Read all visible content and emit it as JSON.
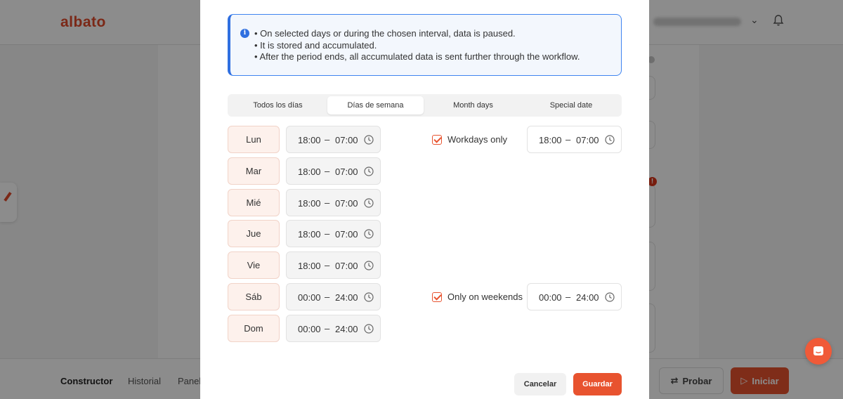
{
  "app": {
    "logo": "albato",
    "footer_tabs": [
      "Constructor",
      "Historial",
      "Panel"
    ],
    "probar_label": "Probar",
    "iniciar_label": "Iniciar"
  },
  "modal": {
    "info_lines": [
      "On selected days or during the chosen interval, data is paused.",
      "It is stored and accumulated.",
      "After the period ends, all accumulated data is sent further through the workflow."
    ],
    "tabs": [
      {
        "label": "Todos los días",
        "active": false
      },
      {
        "label": "Días de semana",
        "active": true
      },
      {
        "label": "Month days",
        "active": false
      },
      {
        "label": "Special date",
        "active": false
      }
    ],
    "days": [
      {
        "label": "Lun",
        "from": "18:00",
        "to": "07:00"
      },
      {
        "label": "Mar",
        "from": "18:00",
        "to": "07:00"
      },
      {
        "label": "Mié",
        "from": "18:00",
        "to": "07:00"
      },
      {
        "label": "Jue",
        "from": "18:00",
        "to": "07:00"
      },
      {
        "label": "Vie",
        "from": "18:00",
        "to": "07:00"
      },
      {
        "label": "Sáb",
        "from": "00:00",
        "to": "24:00"
      },
      {
        "label": "Dom",
        "from": "00:00",
        "to": "24:00"
      }
    ],
    "dash": "–",
    "workdays": {
      "label": "Workdays only",
      "checked": true,
      "from": "18:00",
      "to": "07:00"
    },
    "weekends": {
      "label": "Only on weekends",
      "checked": true,
      "from": "00:00",
      "to": "24:00"
    },
    "cancel_label": "Cancelar",
    "save_label": "Guardar"
  },
  "colors": {
    "accent": "#e8532f",
    "info_border": "#3f84f0",
    "day_bg": "#fdf1ec"
  }
}
